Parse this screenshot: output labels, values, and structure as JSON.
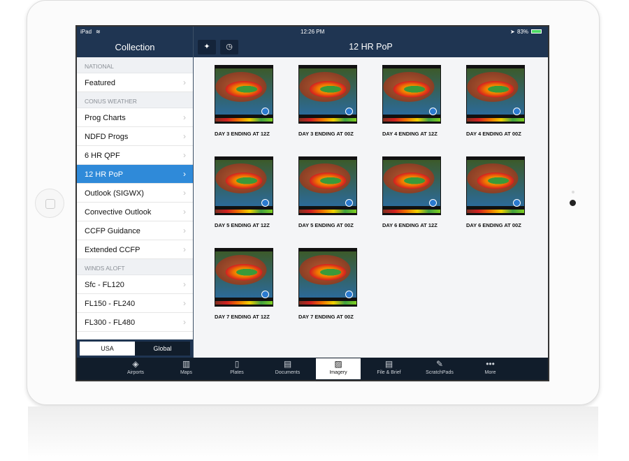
{
  "status": {
    "device": "iPad",
    "time": "12:26 PM",
    "battery": "83%",
    "wifi_icon": "wifi-icon",
    "location_icon": "location-arrow-icon"
  },
  "sidebar": {
    "title": "Collection",
    "sections": [
      {
        "header": "NATIONAL",
        "items": [
          {
            "label": "Featured"
          }
        ]
      },
      {
        "header": "CONUS WEATHER",
        "items": [
          {
            "label": "Prog Charts"
          },
          {
            "label": "NDFD Progs"
          },
          {
            "label": "6 HR QPF"
          },
          {
            "label": "12 HR PoP",
            "active": true
          },
          {
            "label": "Outlook (SIGWX)"
          },
          {
            "label": "Convective Outlook"
          },
          {
            "label": "CCFP Guidance"
          },
          {
            "label": "Extended CCFP"
          }
        ]
      },
      {
        "header": "WINDS ALOFT",
        "items": [
          {
            "label": "Sfc - FL120"
          },
          {
            "label": "FL150 - FL240"
          },
          {
            "label": "FL300 - FL480"
          }
        ]
      }
    ],
    "segment": {
      "options": [
        "USA",
        "Global"
      ],
      "selected": "USA"
    }
  },
  "main": {
    "title": "12 HR PoP",
    "buttons": [
      {
        "icon": "favorites-stars-icon",
        "glyph": "✦"
      },
      {
        "icon": "clock-icon",
        "glyph": "◷"
      }
    ],
    "thumbnails": [
      "DAY 3 ENDING AT 12Z",
      "DAY 3 ENDING AT 00Z",
      "DAY 4 ENDING AT 12Z",
      "DAY 4 ENDING AT 00Z",
      "DAY 5 ENDING AT 12Z",
      "DAY 5 ENDING AT 00Z",
      "DAY 6 ENDING AT 12Z",
      "DAY 6 ENDING AT 00Z",
      "DAY 7 ENDING AT 12Z",
      "DAY 7 ENDING AT 00Z"
    ]
  },
  "tabbar": {
    "active": "Imagery",
    "tabs": [
      {
        "label": "Airports",
        "icon": "airports-icon",
        "glyph": "◈"
      },
      {
        "label": "Maps",
        "icon": "map-icon",
        "glyph": "▥"
      },
      {
        "label": "Plates",
        "icon": "plates-icon",
        "glyph": "▯"
      },
      {
        "label": "Documents",
        "icon": "documents-icon",
        "glyph": "▤"
      },
      {
        "label": "Imagery",
        "icon": "imagery-icon",
        "glyph": "▨"
      },
      {
        "label": "File & Brief",
        "icon": "file-brief-icon",
        "glyph": "▤"
      },
      {
        "label": "ScratchPads",
        "icon": "scratchpad-pen-icon",
        "glyph": "✎"
      },
      {
        "label": "More",
        "icon": "more-dots-icon",
        "glyph": "•••"
      }
    ]
  },
  "colors": {
    "header": "#1f3552",
    "active_item": "#2f8ad9",
    "tabbar": "#111d2b"
  }
}
